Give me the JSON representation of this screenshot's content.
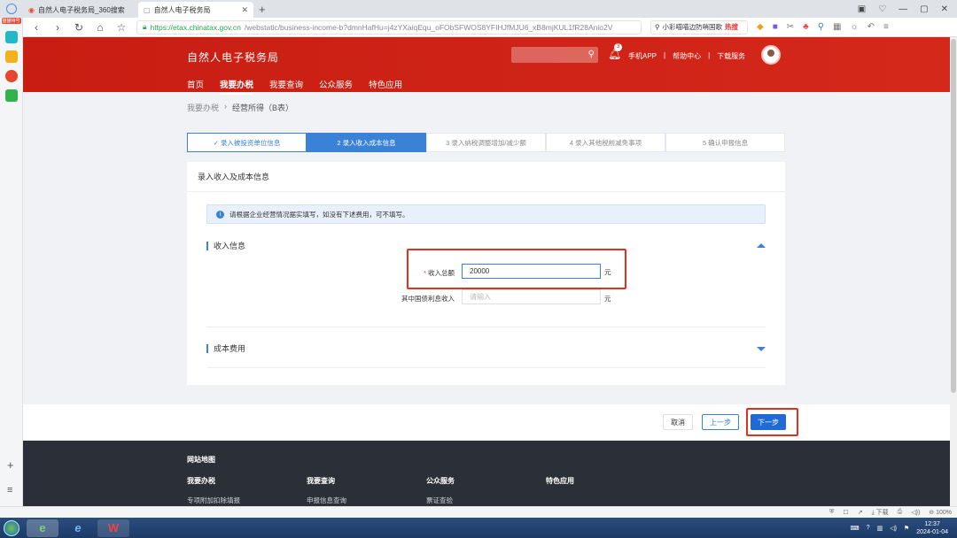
{
  "browser": {
    "tabs": [
      {
        "label": "自然人电子税务局_360搜索"
      },
      {
        "label": "自然人电子税务局"
      }
    ],
    "url_host": "https://etax.chinatax.gov.cn",
    "url_path": "/webstatic/business-income-b?dmnHafHu=j4zYXaiqEqu_oFObSFWOS8YFIHJfMJU6_xB8mjKUL1fR28Anio2V",
    "search_text": "小彩喵喵边防哨国歌",
    "hot_label": "热搜",
    "sidebar_badge": "猫猫特号"
  },
  "site": {
    "title": "自然人电子税务局",
    "notification_count": "3",
    "header_links": [
      "手机APP",
      "帮助中心",
      "下载服务"
    ],
    "menu": [
      "首页",
      "我要办税",
      "我要查询",
      "公众服务",
      "特色应用"
    ]
  },
  "breadcrumb": [
    "我要办税",
    "经营所得（B表）"
  ],
  "steps": [
    "✓ 录入被投资单位信息",
    "2 录入收入成本信息",
    "3 录入纳税调整增加/减少额",
    "4 录入其他税前减免事项",
    "5 确认申报信息"
  ],
  "panel": {
    "title": "录入收入及成本信息",
    "notice": "请根据企业经营情况据实填写，如没有下述费用，可不填写。",
    "income_section": "收入信息",
    "cost_section": "成本费用",
    "fields": {
      "total_income_label": "收入总额",
      "total_income_value": "20000",
      "bond_interest_label": "其中国债利息收入",
      "bond_interest_placeholder": "请输入",
      "unit": "元"
    }
  },
  "actions": {
    "cancel": "取消",
    "prev": "上一步",
    "next": "下一步"
  },
  "footer": {
    "sitemap": "网站地图",
    "cols": [
      "我要办税",
      "我要查询",
      "公众服务",
      "特色应用"
    ],
    "subs": [
      "专项附加扣除填报",
      "申报信息查询",
      "票证查验"
    ]
  },
  "statusbar": {
    "download": "下载",
    "zoom": "100%"
  },
  "taskbar": {
    "time": "12:37",
    "date": "2024-01-04"
  }
}
